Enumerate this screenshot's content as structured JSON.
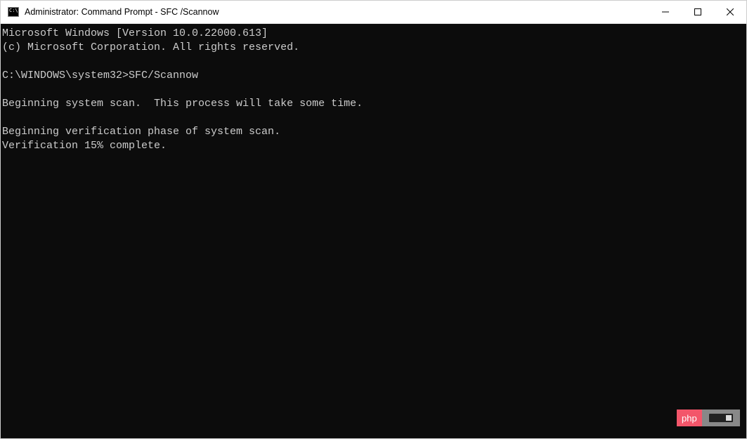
{
  "window": {
    "title": "Administrator: Command Prompt - SFC /Scannow"
  },
  "terminal": {
    "line1": "Microsoft Windows [Version 10.0.22000.613]",
    "line2": "(c) Microsoft Corporation. All rights reserved.",
    "line3": "",
    "prompt_path": "C:\\WINDOWS\\system32>",
    "prompt_cmd": "SFC/Scannow",
    "line5": "",
    "line6": "Beginning system scan.  This process will take some time.",
    "line7": "",
    "line8": "Beginning verification phase of system scan.",
    "line9": "Verification 15% complete."
  },
  "watermark": {
    "label": "php"
  }
}
